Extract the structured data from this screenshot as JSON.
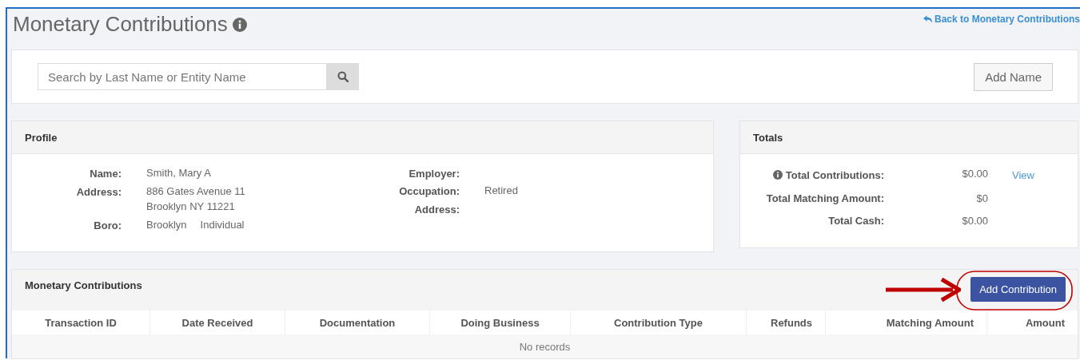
{
  "page": {
    "title": "Monetary Contributions",
    "back_link": "Back to Monetary Contributions"
  },
  "search": {
    "placeholder": "Search by Last Name or Entity Name",
    "add_button": "Add Name"
  },
  "profile": {
    "title": "Profile",
    "left": [
      {
        "label": "Name:",
        "values": [
          "Smith, Mary A"
        ]
      },
      {
        "label": "Address:",
        "values": [
          "886 Gates Avenue 11\nBrooklyn NY 11221"
        ]
      },
      {
        "label": "Boro:",
        "values": [
          "Brooklyn",
          "Individual"
        ]
      }
    ],
    "right": [
      {
        "label": "Employer:"
      },
      {
        "label": "Occupation:",
        "values": [
          "Retired"
        ]
      },
      {
        "label": "Address:"
      }
    ]
  },
  "totals": {
    "title": "Totals",
    "rows": [
      {
        "label": "Total Contributions:",
        "value": "$0.00",
        "link": "View",
        "info": true
      },
      {
        "label": "Total Matching Amount:",
        "value": "$0",
        "info": false
      },
      {
        "label": "Total Cash:",
        "value": "$0.00",
        "info": false
      }
    ]
  },
  "table": {
    "title": "Monetary Contributions",
    "add_button": "Add Contribution",
    "columns": [
      "Transaction ID",
      "Date Received",
      "Documentation",
      "Doing Business",
      "Contribution Type",
      "Refunds",
      "Matching Amount",
      "Amount"
    ],
    "empty_text": "No records"
  }
}
